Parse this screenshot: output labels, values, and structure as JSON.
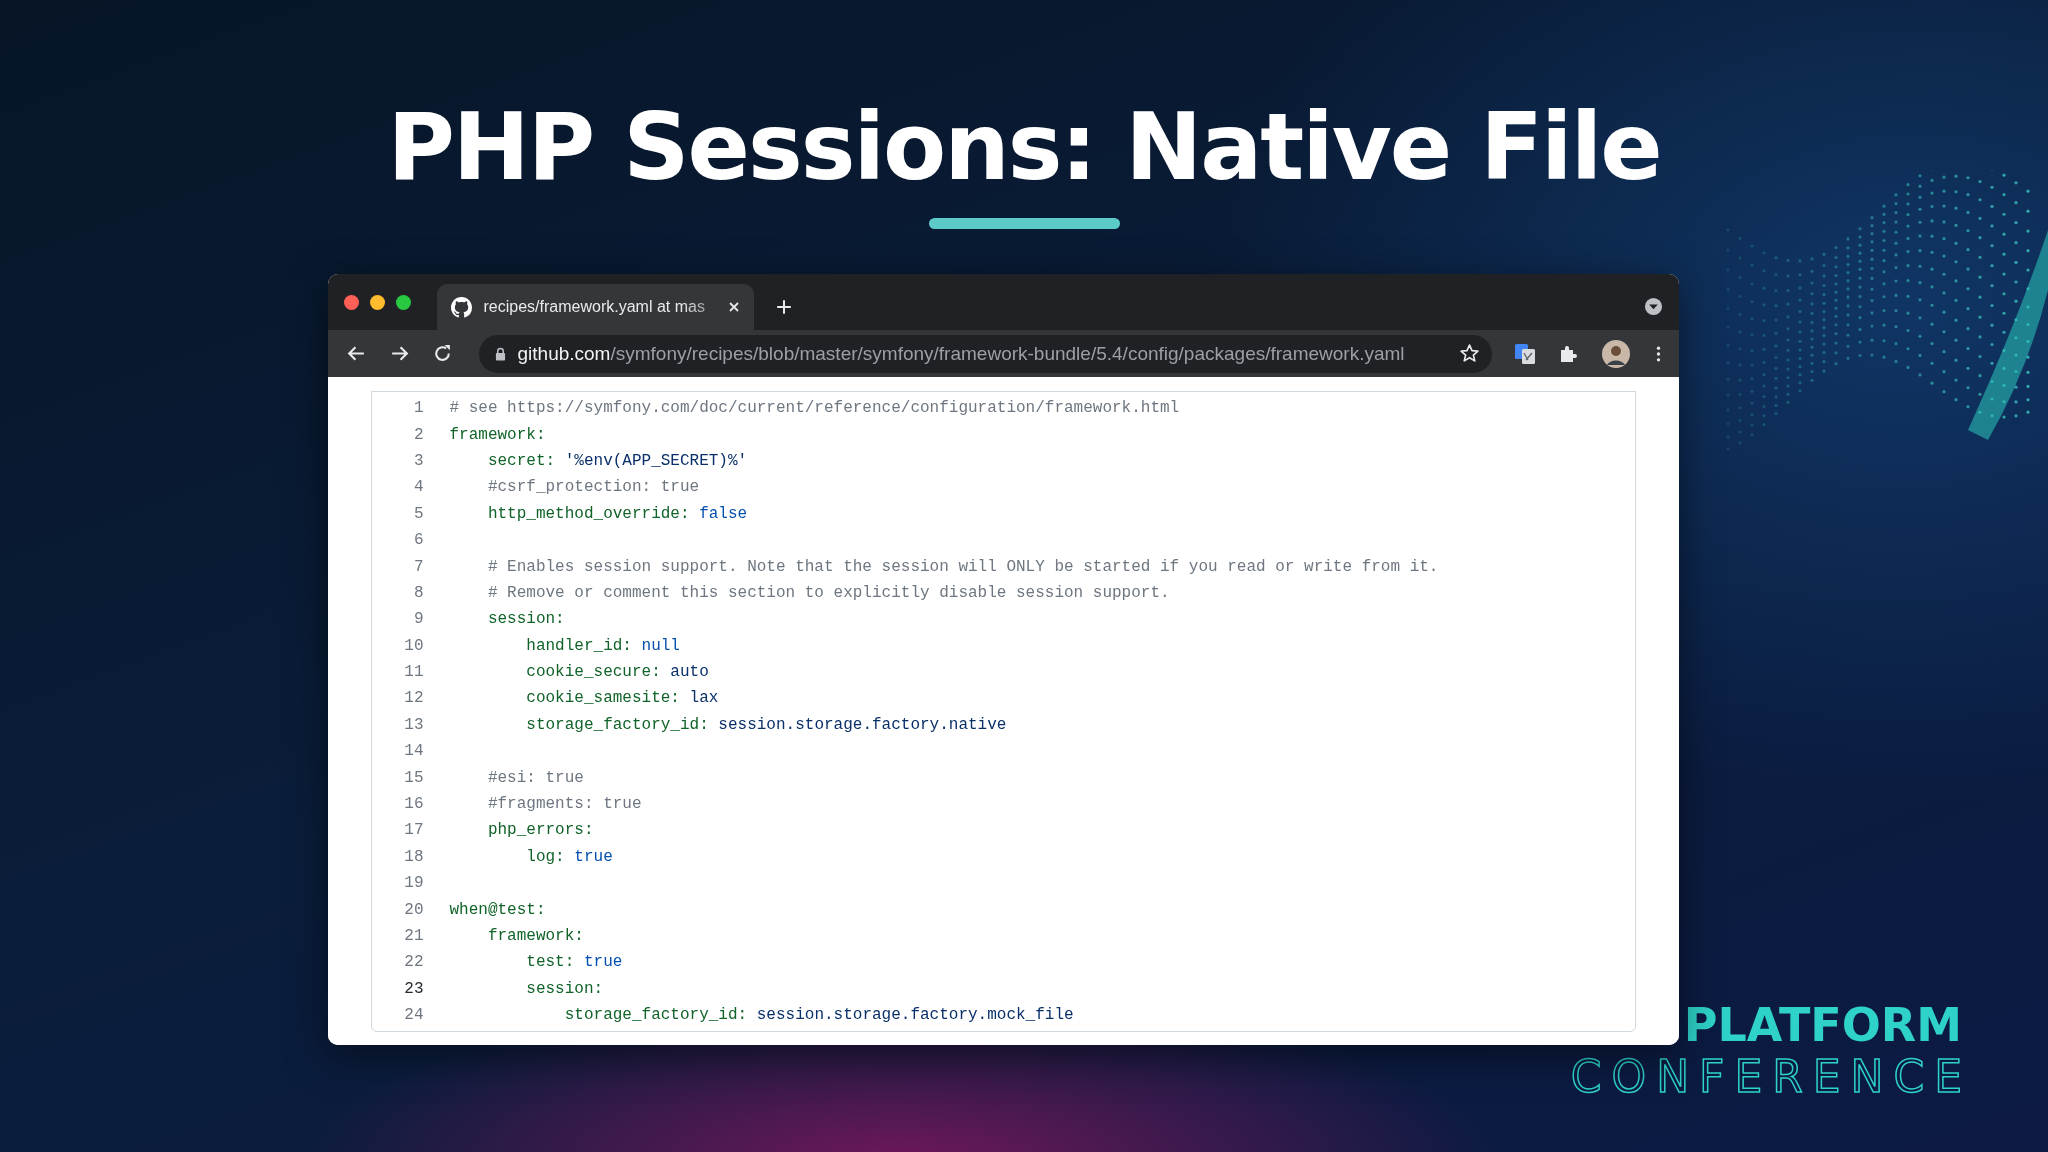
{
  "slide": {
    "title": "PHP Sessions: Native File"
  },
  "browser": {
    "tab": {
      "title": "recipes/framework.yaml at mas"
    },
    "address": {
      "host": "github.com",
      "path": "/symfony/recipes/blob/master/symfony/framework-bundle/5.4/config/packages/framework.yaml"
    }
  },
  "code": {
    "lines": [
      {
        "number": "1",
        "highlighted": false,
        "tokens": [
          {
            "kind": "comment",
            "text": "# see https://symfony.com/doc/current/reference/configuration/framework.html"
          }
        ]
      },
      {
        "number": "2",
        "highlighted": false,
        "tokens": [
          {
            "kind": "key",
            "text": "framework:"
          }
        ]
      },
      {
        "number": "3",
        "highlighted": false,
        "tokens": [
          {
            "kind": "key",
            "text": "    secret:"
          },
          {
            "kind": "value",
            "text": " '%env(APP_SECRET)%'"
          }
        ]
      },
      {
        "number": "4",
        "highlighted": false,
        "tokens": [
          {
            "kind": "comment",
            "text": "    #csrf_protection: true"
          }
        ]
      },
      {
        "number": "5",
        "highlighted": false,
        "tokens": [
          {
            "kind": "key",
            "text": "    http_method_override:"
          },
          {
            "kind": "literal",
            "text": " false"
          }
        ]
      },
      {
        "number": "6",
        "highlighted": false
      },
      {
        "number": "7",
        "highlighted": false,
        "tokens": [
          {
            "kind": "comment",
            "text": "    # Enables session support. Note that the session will ONLY be started if you read or write from it."
          }
        ]
      },
      {
        "number": "8",
        "highlighted": false,
        "tokens": [
          {
            "kind": "comment",
            "text": "    # Remove or comment this section to explicitly disable session support."
          }
        ]
      },
      {
        "number": "9",
        "highlighted": false,
        "tokens": [
          {
            "kind": "key",
            "text": "    session:"
          }
        ]
      },
      {
        "number": "10",
        "highlighted": false,
        "tokens": [
          {
            "kind": "key",
            "text": "        handler_id:"
          },
          {
            "kind": "literal",
            "text": " null"
          }
        ]
      },
      {
        "number": "11",
        "highlighted": false,
        "tokens": [
          {
            "kind": "key",
            "text": "        cookie_secure:"
          },
          {
            "kind": "value",
            "text": " auto"
          }
        ]
      },
      {
        "number": "12",
        "highlighted": false,
        "tokens": [
          {
            "kind": "key",
            "text": "        cookie_samesite:"
          },
          {
            "kind": "value",
            "text": " lax"
          }
        ]
      },
      {
        "number": "13",
        "highlighted": false,
        "tokens": [
          {
            "kind": "key",
            "text": "        storage_factory_id:"
          },
          {
            "kind": "value",
            "text": " session.storage.factory.native"
          }
        ]
      },
      {
        "number": "14",
        "highlighted": false
      },
      {
        "number": "15",
        "highlighted": false,
        "tokens": [
          {
            "kind": "comment",
            "text": "    #esi: true"
          }
        ]
      },
      {
        "number": "16",
        "highlighted": false,
        "tokens": [
          {
            "kind": "comment",
            "text": "    #fragments: true"
          }
        ]
      },
      {
        "number": "17",
        "highlighted": false,
        "tokens": [
          {
            "kind": "key",
            "text": "    php_errors:"
          }
        ]
      },
      {
        "number": "18",
        "highlighted": false,
        "tokens": [
          {
            "kind": "key",
            "text": "        log:"
          },
          {
            "kind": "literal",
            "text": " true"
          }
        ]
      },
      {
        "number": "19",
        "highlighted": false
      },
      {
        "number": "20",
        "highlighted": false,
        "tokens": [
          {
            "kind": "key",
            "text": "when@test:"
          }
        ]
      },
      {
        "number": "21",
        "highlighted": false,
        "tokens": [
          {
            "kind": "key",
            "text": "    framework:"
          }
        ]
      },
      {
        "number": "22",
        "highlighted": false,
        "tokens": [
          {
            "kind": "key",
            "text": "        test:"
          },
          {
            "kind": "literal",
            "text": " true"
          }
        ]
      },
      {
        "number": "23",
        "highlighted": true,
        "tokens": [
          {
            "kind": "key",
            "text": "        session:"
          }
        ]
      },
      {
        "number": "24",
        "highlighted": false,
        "tokens": [
          {
            "kind": "key",
            "text": "            storage_factory_id:"
          },
          {
            "kind": "value",
            "text": " session.storage.factory.mock_file"
          }
        ]
      }
    ]
  },
  "logo": {
    "line_1": "PLATFORM",
    "line_2": "CONFERENCE"
  }
}
